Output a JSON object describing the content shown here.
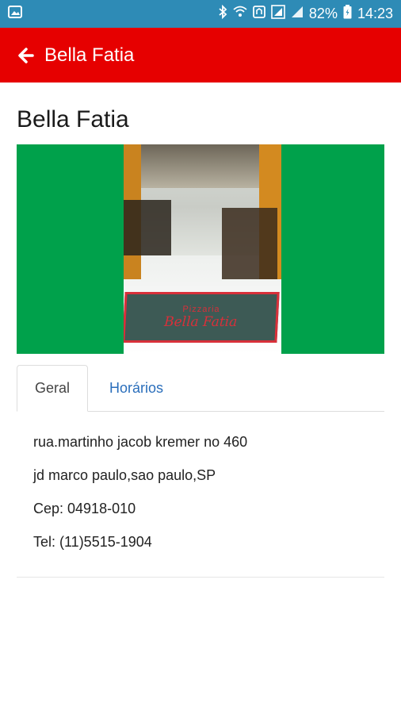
{
  "status_bar": {
    "battery": "82%",
    "time": "14:23",
    "icons": [
      "image-icon",
      "bluetooth-icon",
      "wifi-icon",
      "nfc-icon",
      "data-icon",
      "signal-icon",
      "battery-icon"
    ]
  },
  "app_bar": {
    "title": "Bella Fatia",
    "back_icon": "arrow-left-icon",
    "color": "#e60000"
  },
  "page": {
    "title": "Bella Fatia",
    "hero_bg_color": "#00a14b",
    "mat_line1": "Pizzaria",
    "mat_line2": "Bella Fatia"
  },
  "tabs": [
    {
      "label": "Geral",
      "active": true
    },
    {
      "label": "Horários",
      "active": false
    }
  ],
  "info": {
    "address": "rua.martinho jacob kremer no 460",
    "district": "jd marco paulo,sao paulo,SP",
    "cep": "Cep: 04918-010",
    "tel": "Tel: (11)5515-1904"
  }
}
